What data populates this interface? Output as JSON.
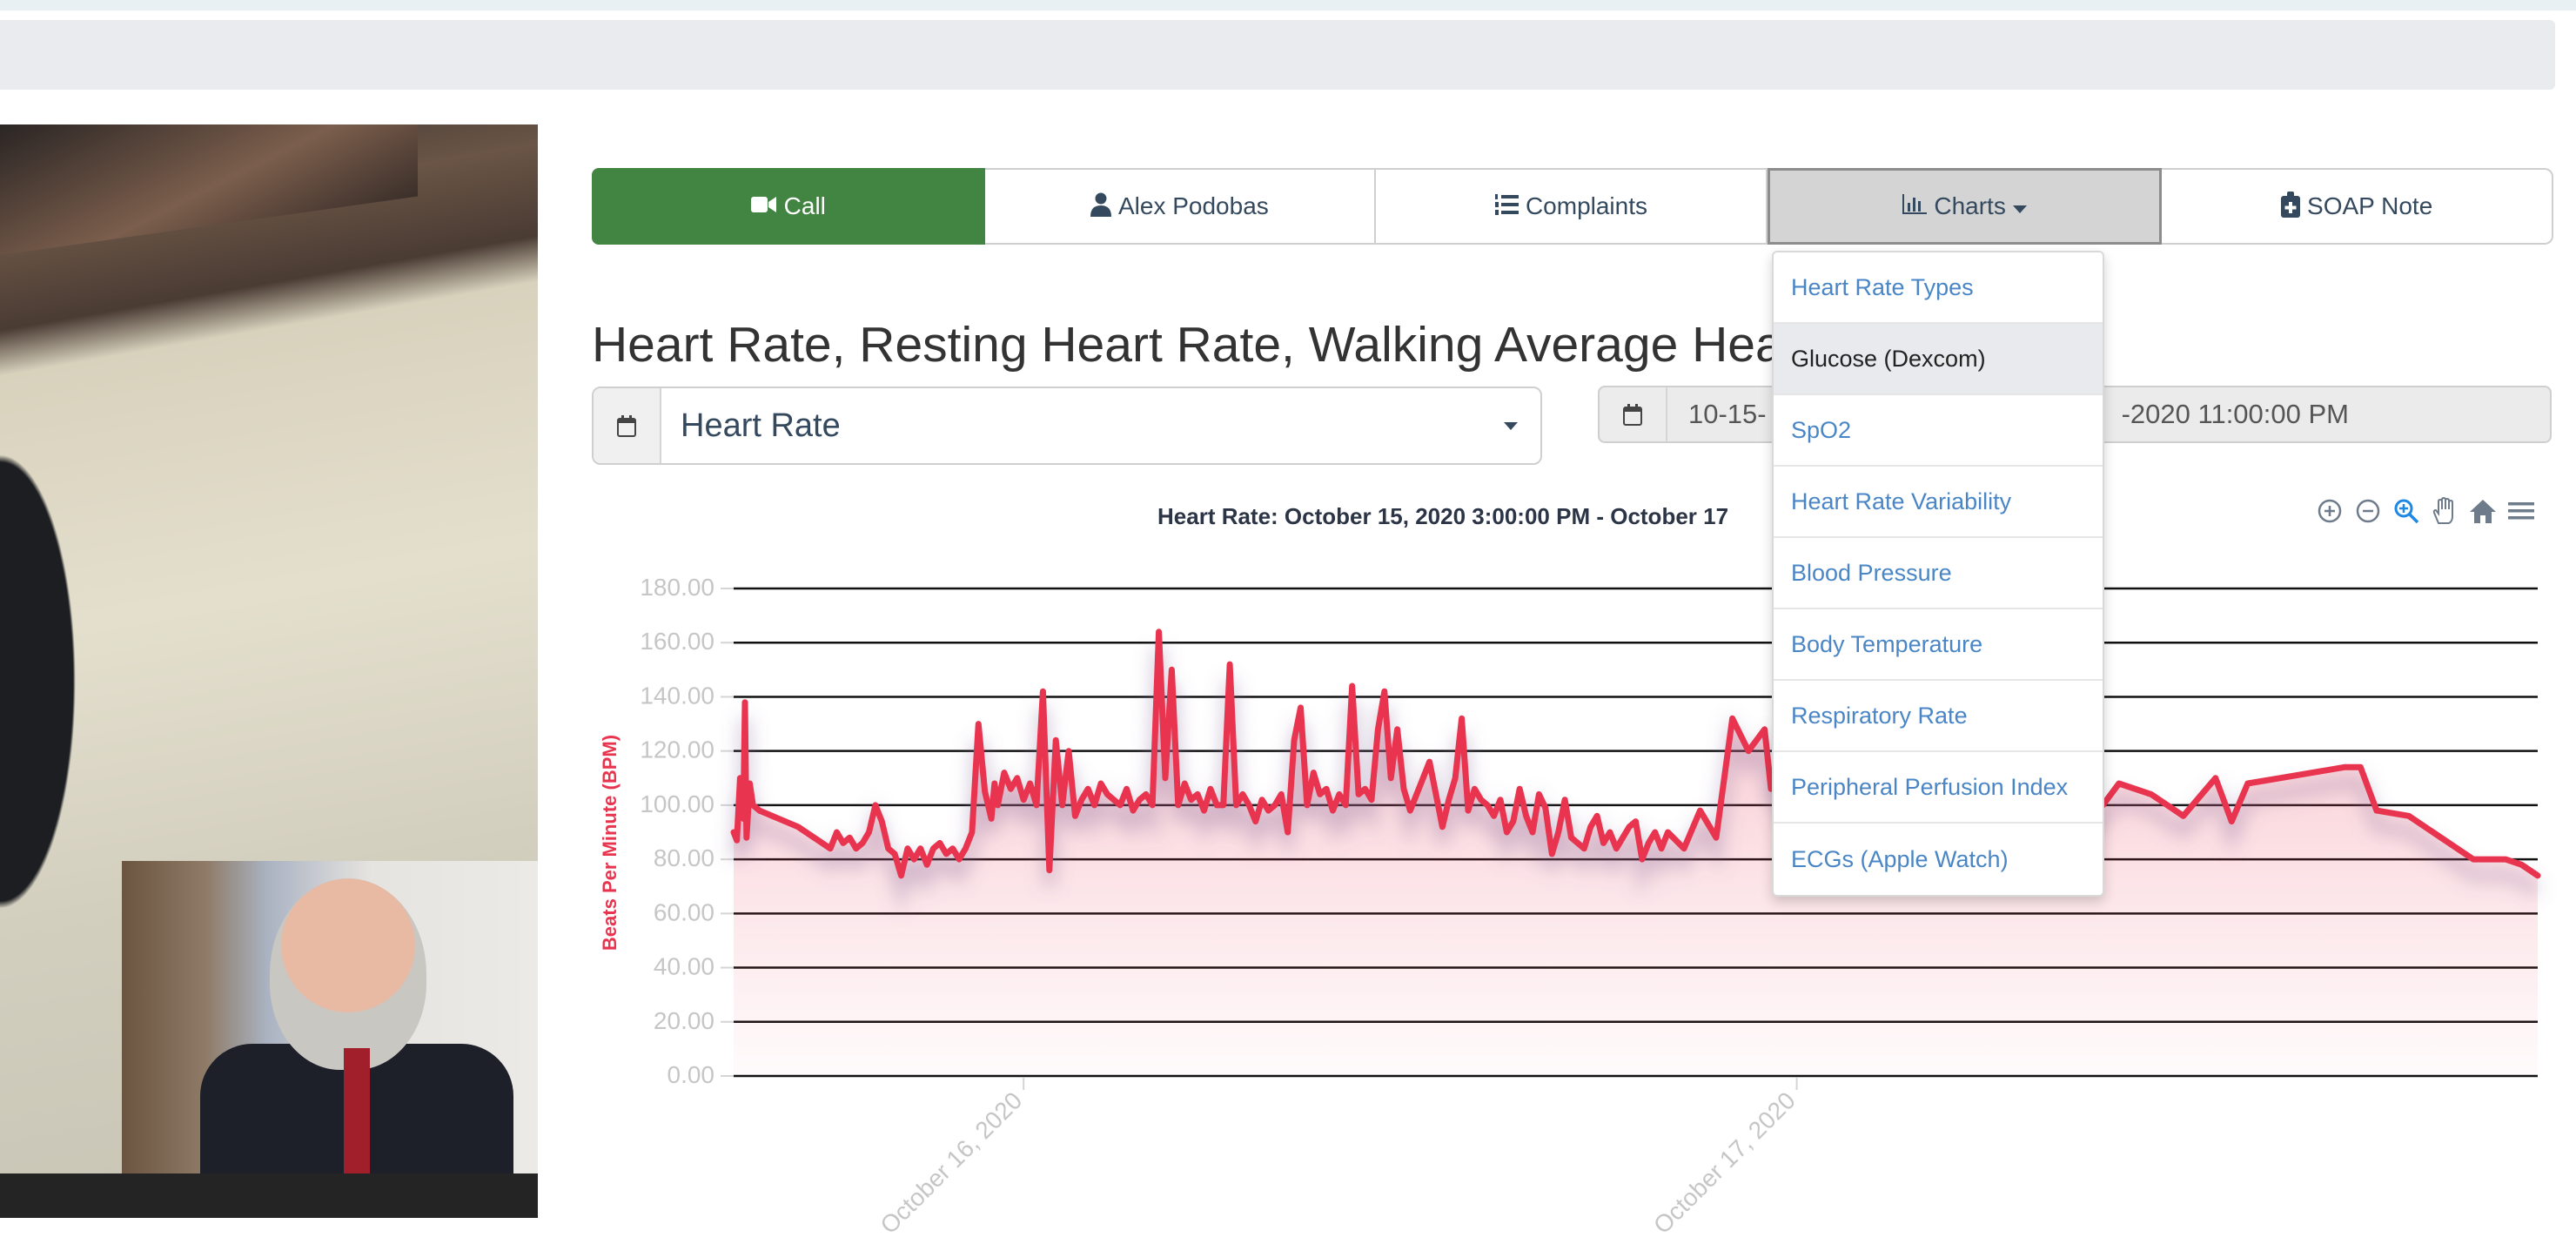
{
  "video": {
    "remote_label": "Remote video feed",
    "local_label": "Local video feed"
  },
  "tabs": [
    {
      "id": "call",
      "icon": "video-camera-icon",
      "label": "Call"
    },
    {
      "id": "patient",
      "icon": "user-icon",
      "label": "Alex Podobas"
    },
    {
      "id": "complaints",
      "icon": "numbered-list-icon",
      "label": "Complaints"
    },
    {
      "id": "charts",
      "icon": "bar-chart-icon",
      "label": "Charts",
      "active": true
    },
    {
      "id": "soap",
      "icon": "medical-clipboard-icon",
      "label": "SOAP Note"
    }
  ],
  "charts_menu": {
    "items": [
      {
        "label": "Heart Rate Types"
      },
      {
        "label": "Glucose (Dexcom)",
        "hovered": true
      },
      {
        "label": "SpO2"
      },
      {
        "label": "Heart Rate Variability"
      },
      {
        "label": "Blood Pressure"
      },
      {
        "label": "Body Temperature"
      },
      {
        "label": "Respiratory Rate"
      },
      {
        "label": "Peripheral Perfusion Index"
      },
      {
        "label": "ECGs (Apple Watch)"
      }
    ]
  },
  "page": {
    "title": "Heart Rate, Resting Heart Rate, Walking Average Hea"
  },
  "metric_select": {
    "value": "Heart Rate"
  },
  "date_range": {
    "value_start": "10-15-",
    "value_end": "-2020 11:00:00 PM"
  },
  "chart_tools": [
    {
      "name": "zoom-in-icon",
      "glyph": "⊕"
    },
    {
      "name": "zoom-out-icon",
      "glyph": "⊖"
    },
    {
      "name": "selection-zoom-icon",
      "glyph": "🔍"
    },
    {
      "name": "pan-hand-icon",
      "glyph": "✋"
    },
    {
      "name": "reset-home-icon",
      "glyph": "⌂"
    },
    {
      "name": "menu-icon",
      "glyph": "≡"
    }
  ],
  "colors": {
    "series": "#e8344f",
    "call_green": "#428542",
    "link_blue": "#4a86c5"
  },
  "chart_data": {
    "type": "area",
    "title": "Heart Rate: October 15, 2020 3:00:00 PM - October 17",
    "xlabel": "",
    "ylabel": "Beats Per Minute (BPM)",
    "ylim": [
      0,
      180
    ],
    "yticks": [
      "0.00",
      "20.00",
      "40.00",
      "60.00",
      "80.00",
      "100.00",
      "120.00",
      "140.00",
      "160.00",
      "180.00"
    ],
    "xticks": [
      {
        "label": "October 16, 2020",
        "hours": 9
      },
      {
        "label": "October 17, 2020",
        "hours": 33
      }
    ],
    "xlim_hours": [
      0,
      56
    ],
    "grid": true,
    "series": [
      {
        "name": "Heart Rate",
        "x_hours": [
          0,
          0.1,
          0.2,
          0.3,
          0.35,
          0.4,
          0.5,
          0.6,
          0.7,
          0.8,
          1.0,
          2.0,
          3.0,
          3.2,
          3.4,
          3.6,
          3.8,
          4.0,
          4.2,
          4.4,
          4.6,
          4.8,
          5.0,
          5.2,
          5.4,
          5.6,
          5.8,
          6.0,
          6.2,
          6.4,
          6.6,
          6.8,
          7.0,
          7.2,
          7.4,
          7.6,
          7.8,
          8.0,
          8.1,
          8.2,
          8.4,
          8.6,
          8.8,
          9.0,
          9.2,
          9.4,
          9.6,
          9.8,
          10.0,
          10.2,
          10.4,
          10.6,
          10.8,
          11.0,
          11.2,
          11.4,
          11.6,
          11.8,
          12.0,
          12.2,
          12.4,
          12.6,
          12.8,
          13.0,
          13.2,
          13.4,
          13.6,
          13.8,
          14.0,
          14.2,
          14.4,
          14.6,
          14.8,
          15.0,
          15.2,
          15.4,
          15.6,
          15.8,
          16.0,
          16.2,
          16.4,
          16.6,
          16.8,
          17.0,
          17.2,
          17.4,
          17.6,
          17.8,
          18.0,
          18.2,
          18.4,
          18.6,
          18.8,
          19.0,
          19.2,
          19.4,
          19.6,
          19.8,
          20.0,
          20.2,
          20.4,
          20.6,
          20.8,
          21.0,
          21.2,
          21.4,
          21.6,
          21.8,
          22.0,
          22.2,
          22.4,
          22.6,
          22.8,
          23.0,
          23.2,
          23.4,
          23.6,
          23.8,
          24.0,
          24.2,
          24.4,
          24.6,
          24.8,
          25.0,
          25.2,
          25.4,
          25.6,
          25.8,
          26.0,
          26.2,
          26.4,
          26.6,
          26.8,
          27.0,
          27.2,
          27.4,
          27.6,
          27.8,
          28.0,
          28.2,
          28.4,
          28.6,
          28.8,
          29.0,
          29.5,
          30.0,
          30.5,
          31.0,
          31.5,
          32.0,
          32.2,
          32.4,
          32.6,
          32.8,
          33.0,
          33.2,
          33.4,
          33.6,
          33.8,
          34.0,
          34.2,
          34.4,
          34.6,
          34.8,
          35.0,
          35.2,
          35.4,
          35.6,
          35.8,
          36.0,
          36.2,
          36.4,
          36.6,
          36.8,
          37.0,
          37.2,
          37.4,
          37.6,
          37.8,
          38.0,
          38.2,
          38.4,
          38.6,
          38.8,
          39.0,
          39.2,
          39.4,
          39.6,
          39.8,
          40.0,
          40.2,
          40.4,
          40.6,
          40.8,
          41.0,
          41.5,
          42.0,
          42.5,
          43.0,
          44.0,
          45.0,
          46.0,
          46.5,
          47.0,
          48.0,
          49.0,
          50.0,
          50.5,
          51.0,
          52.0,
          53.0,
          54.0,
          55.0,
          55.5,
          56.0
        ],
        "values": [
          90,
          87,
          110,
          95,
          138,
          88,
          108,
          100,
          99,
          98,
          97,
          92,
          84,
          90,
          86,
          88,
          84,
          86,
          90,
          100,
          94,
          84,
          82,
          74,
          84,
          80,
          84,
          78,
          84,
          86,
          82,
          84,
          80,
          84,
          90,
          130,
          105,
          95,
          108,
          100,
          112,
          106,
          110,
          102,
          108,
          100,
          142,
          76,
          124,
          100,
          120,
          96,
          102,
          106,
          100,
          108,
          104,
          102,
          100,
          106,
          98,
          102,
          104,
          100,
          164,
          110,
          150,
          100,
          108,
          102,
          104,
          98,
          106,
          100,
          100,
          152,
          100,
          104,
          100,
          94,
          102,
          98,
          100,
          104,
          90,
          124,
          136,
          100,
          112,
          104,
          106,
          98,
          104,
          100,
          144,
          104,
          106,
          102,
          128,
          142,
          110,
          128,
          106,
          98,
          104,
          110,
          116,
          104,
          92,
          102,
          110,
          132,
          98,
          106,
          102,
          100,
          96,
          102,
          90,
          94,
          106,
          96,
          90,
          104,
          99,
          82,
          90,
          102,
          88,
          86,
          84,
          92,
          96,
          86,
          90,
          84,
          88,
          92,
          94,
          80,
          86,
          90,
          84,
          90,
          84,
          98,
          88,
          132,
          120,
          128,
          106,
          118,
          100,
          96,
          90,
          108,
          98,
          112,
          106,
          116,
          100,
          104,
          98,
          96,
          110,
          94,
          112,
          104,
          114,
          100,
          108,
          98,
          104,
          112,
          96,
          86,
          128,
          112,
          98,
          104,
          100,
          96,
          86,
          102,
          92,
          100,
          96,
          98,
          118,
          116,
          122,
          118,
          96,
          94,
          100,
          92,
          96,
          100,
          108,
          104,
          96,
          110,
          94,
          108,
          110,
          112,
          114,
          114,
          98,
          96,
          88,
          80,
          80,
          78,
          74,
          82,
          80,
          76,
          80,
          82,
          84,
          86,
          85,
          80,
          84
        ]
      }
    ]
  }
}
